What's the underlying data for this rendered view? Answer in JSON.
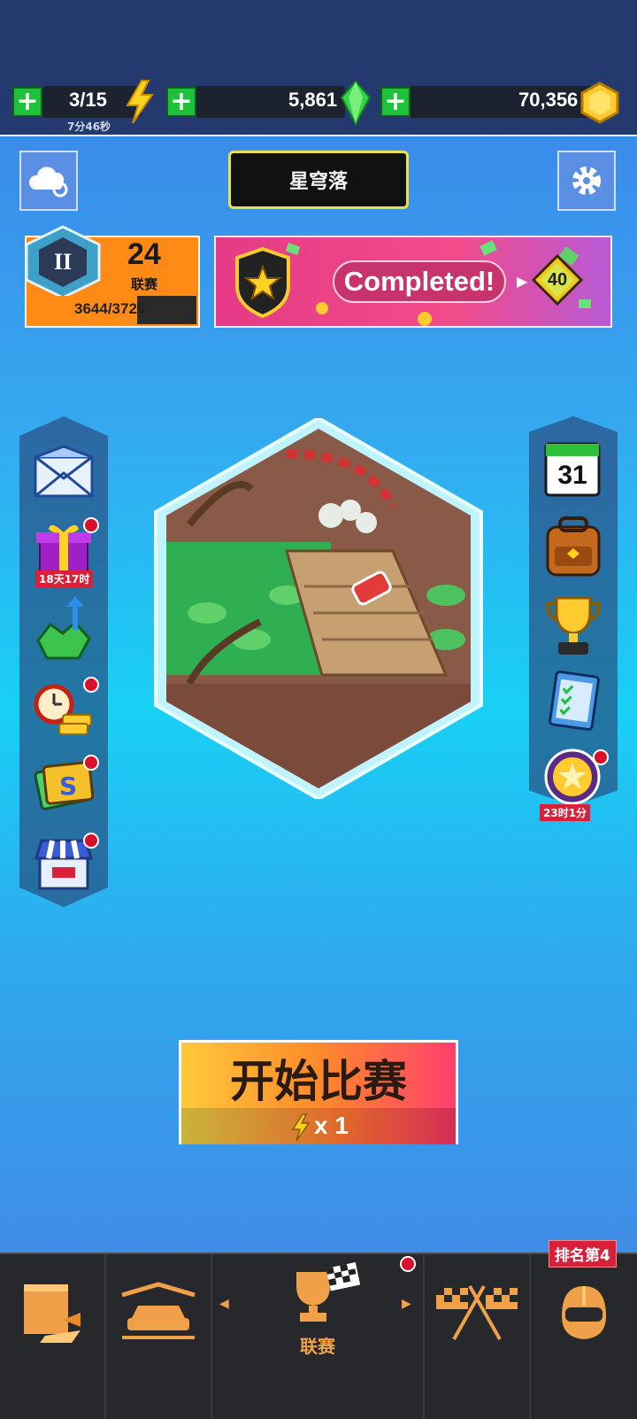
{
  "resources": {
    "energy": {
      "value": "3/15",
      "timer": "7分46秒"
    },
    "gems": {
      "value": "5,861"
    },
    "coins": {
      "value": "70,356"
    }
  },
  "track_name": "星穹落",
  "league": {
    "rank_numeral": "II",
    "level": "24",
    "label": "联赛",
    "progress_text": "3644/3720",
    "progress": 0.979
  },
  "event_banner": {
    "text": "Completed!",
    "reward": "40"
  },
  "left_menu": {
    "gift_timer": "18天17时"
  },
  "right_menu": {
    "calendar_day": "31",
    "medal_timer": "23时1分"
  },
  "start_button": {
    "label": "开始比赛",
    "cost": "x 1"
  },
  "bottom_nav": {
    "active_tab_label": "联赛",
    "rank_badge": "排名第4"
  },
  "colors": {
    "accent_green": "#1fc13a",
    "top_bar": "#243a6e",
    "bottom_bar": "#26282c",
    "badge_red": "#d8102b"
  }
}
